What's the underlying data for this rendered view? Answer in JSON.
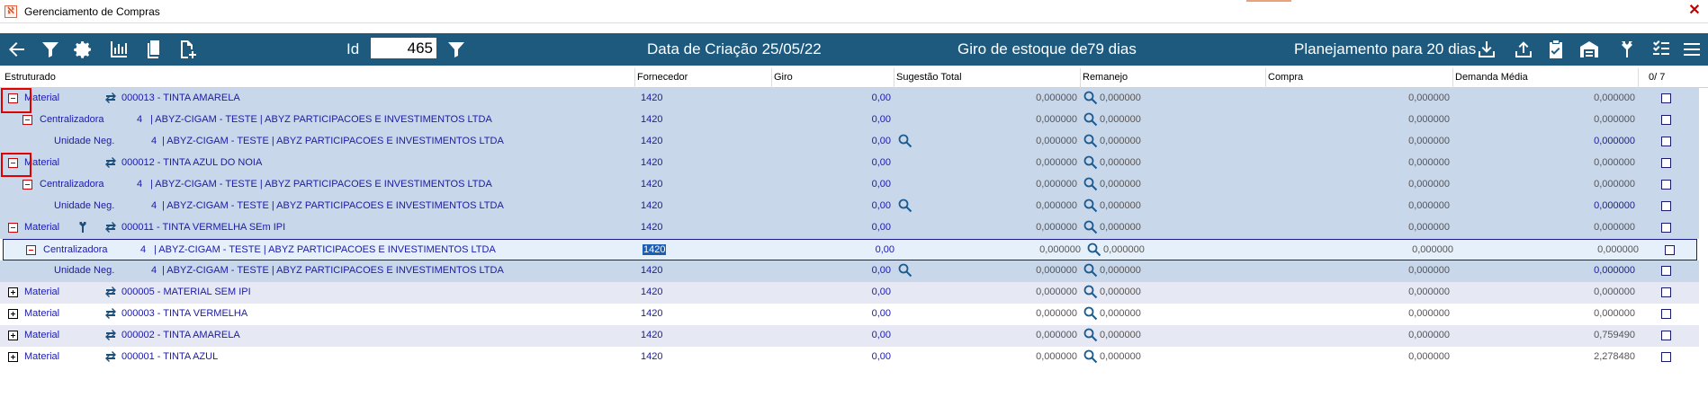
{
  "window": {
    "title": "Gerenciamento de Compras",
    "icon": "app-icon"
  },
  "toolbar": {
    "id_label": "Id",
    "id_value": "465",
    "creation_date": "Data de Criação 25/05/22",
    "stock_turnover_label": "Giro de estoque de",
    "stock_turnover_value": "79 dias",
    "planning": "Planejamento para 20 dias",
    "left_icons": [
      "back-arrow-icon",
      "filter-icon",
      "gear-icon",
      "bar-chart-icon",
      "copy-documents-icon",
      "new-document-icon"
    ],
    "right_icons": [
      "download-icon",
      "upload-icon",
      "clipboard-check-icon",
      "warehouse-icon",
      "fork-icon",
      "checklist-icon",
      "menu-icon"
    ]
  },
  "columns": {
    "estruturado": "Estruturado",
    "fornecedor": "Fornecedor",
    "giro": "Giro",
    "sugestao_total": "Sugestão Total",
    "remanejo": "Remanejo",
    "compra": "Compra",
    "demanda_media": "Demanda Média",
    "count": "0/ 7"
  },
  "rows": [
    {
      "level": "material",
      "toggle": "minus",
      "label": "Material",
      "code": "000013 - TINTA AMARELA",
      "fornecedor": "1420",
      "giro": "0,00",
      "sugestao": "0,000000",
      "remanejo": "0,000000",
      "compra": "0,000000",
      "demanda": "0,000000"
    },
    {
      "level": "centralizadora",
      "toggle": "minus",
      "label": "Centralizadora",
      "code": "4",
      "desc": "| ABYZ-CIGAM - TESTE | ABYZ PARTICIPACOES E INVESTIMENTOS LTDA",
      "fornecedor": "1420",
      "giro": "0,00",
      "sugestao": "0,000000",
      "remanejo": "0,000000",
      "compra": "0,000000",
      "demanda": "0,000000"
    },
    {
      "level": "unidade",
      "label": "Unidade Neg.",
      "code": "4",
      "desc": "| ABYZ-CIGAM - TESTE | ABYZ PARTICIPACOES E INVESTIMENTOS LTDA",
      "fornecedor": "1420",
      "giro": "0,00",
      "sugestao": "0,000000",
      "remanejo": "0,000000",
      "compra": "0,000000",
      "demanda": "0,000000"
    },
    {
      "level": "material",
      "toggle": "minus",
      "label": "Material",
      "code": "000012 - TINTA AZUL DO NOIA",
      "fornecedor": "1420",
      "giro": "0,00",
      "sugestao": "0,000000",
      "remanejo": "0,000000",
      "compra": "0,000000",
      "demanda": "0,000000"
    },
    {
      "level": "centralizadora",
      "toggle": "minus",
      "label": "Centralizadora",
      "code": "4",
      "desc": "| ABYZ-CIGAM - TESTE | ABYZ PARTICIPACOES E INVESTIMENTOS LTDA",
      "fornecedor": "1420",
      "giro": "0,00",
      "sugestao": "0,000000",
      "remanejo": "0,000000",
      "compra": "0,000000",
      "demanda": "0,000000"
    },
    {
      "level": "unidade",
      "label": "Unidade Neg.",
      "code": "4",
      "desc": "| ABYZ-CIGAM - TESTE | ABYZ PARTICIPACOES E INVESTIMENTOS LTDA",
      "fornecedor": "1420",
      "giro": "0,00",
      "sugestao": "0,000000",
      "remanejo": "0,000000",
      "compra": "0,000000",
      "demanda": "0,000000"
    },
    {
      "level": "material",
      "toggle": "minus",
      "label": "Material",
      "code": "000011 - TINTA VERMELHA SEm IPI",
      "fornecedor": "1420",
      "giro": "0,00",
      "sugestao": "0,000000",
      "remanejo": "0,000000",
      "compra": "0,000000",
      "demanda": "0,000000"
    },
    {
      "level": "centralizadora",
      "toggle": "minus",
      "label": "Centralizadora",
      "code": "4",
      "desc": "| ABYZ-CIGAM - TESTE | ABYZ PARTICIPACOES E INVESTIMENTOS LTDA",
      "fornecedor": "1420",
      "giro": "0,00",
      "sugestao": "0,000000",
      "remanejo": "0,000000",
      "compra": "0,000000",
      "demanda": "0,000000"
    },
    {
      "level": "unidade",
      "label": "Unidade Neg.",
      "code": "4",
      "desc": "| ABYZ-CIGAM - TESTE | ABYZ PARTICIPACOES E INVESTIMENTOS LTDA",
      "fornecedor": "1420",
      "giro": "0,00",
      "sugestao": "0,000000",
      "remanejo": "0,000000",
      "compra": "0,000000",
      "demanda": "0,000000"
    },
    {
      "level": "material",
      "toggle": "plus",
      "label": "Material",
      "code": "000005 - MATERIAL SEM IPI",
      "fornecedor": "1420",
      "giro": "0,00",
      "sugestao": "0,000000",
      "remanejo": "0,000000",
      "compra": "0,000000",
      "demanda": "0,000000"
    },
    {
      "level": "material",
      "toggle": "plus",
      "label": "Material",
      "code": "000003 - TINTA VERMELHA",
      "fornecedor": "1420",
      "giro": "0,00",
      "sugestao": "0,000000",
      "remanejo": "0,000000",
      "compra": "0,000000",
      "demanda": "0,000000"
    },
    {
      "level": "material",
      "toggle": "plus",
      "label": "Material",
      "code": "000002 - TINTA AMARELA",
      "fornecedor": "1420",
      "giro": "0,00",
      "sugestao": "0,000000",
      "remanejo": "0,000000",
      "compra": "0,000000",
      "demanda": "0,759490"
    },
    {
      "level": "material",
      "toggle": "plus",
      "label": "Material",
      "code": "000001 - TINTA AZUL",
      "fornecedor": "1420",
      "giro": "0,00",
      "sugestao": "0,000000",
      "remanejo": "0,000000",
      "compra": "0,000000",
      "demanda": "2,278480"
    }
  ],
  "colors": {
    "toolbar": "#1d5a7e",
    "row_expanded": "#c9d7ea",
    "row_band": "#e6e8f4",
    "text_link": "#1a1aa8",
    "highlight": "#e00000"
  }
}
